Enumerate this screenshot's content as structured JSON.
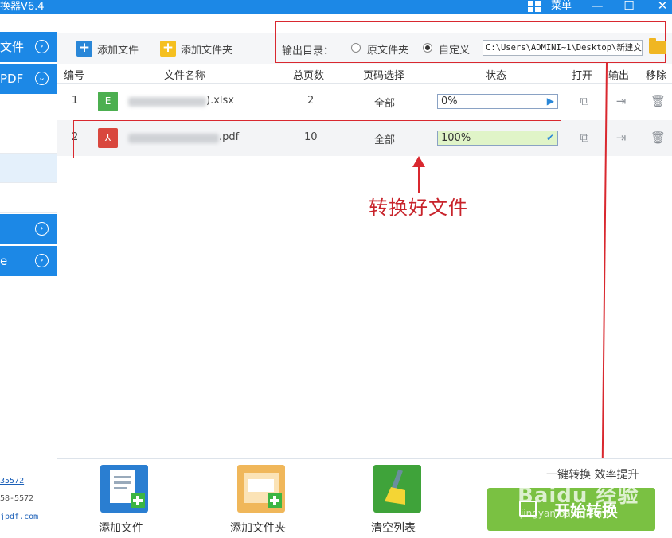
{
  "titlebar": {
    "app_title": "换器V6.4",
    "menu_label": "菜单",
    "minimize": "—",
    "maximize": "☐",
    "close": "✕"
  },
  "sidebar": {
    "section1": "文件",
    "section2": "PDF",
    "section3": "",
    "section4": "e",
    "link1": "35572",
    "phone": "58-5572",
    "link2": "jpdf.com"
  },
  "toolbar": {
    "add_file": "添加文件",
    "add_folder": "添加文件夹",
    "output_label": "输出目录：",
    "radio_original": "原文件夹",
    "radio_custom": "自定义",
    "output_path": "C:\\Users\\ADMINI~1\\Desktop\\新建文"
  },
  "table": {
    "headers": [
      "编号",
      "文件名称",
      "总页数",
      "页码选择",
      "状态",
      "打开",
      "输出",
      "移除"
    ],
    "rows": [
      {
        "index": "1",
        "type_letter": "E",
        "name_suffix": ").xlsx",
        "pages": "2",
        "page_select": "全部",
        "progress": "0%",
        "progress_fraction": 0
      },
      {
        "index": "2",
        "type_letter": "⅄",
        "name_suffix": ".pdf",
        "pages": "10",
        "page_select": "全部",
        "progress": "100%",
        "progress_fraction": 1
      }
    ]
  },
  "annotation": "转换好文件",
  "bottom": {
    "add_file": "添加文件",
    "add_folder": "添加文件夹",
    "clear_list": "清空列表",
    "slogan": "一键转换 效率提升",
    "start": "开始转换",
    "watermark": "Baidu 经验",
    "watermark_url": "jingyan.baidu.com"
  },
  "colors": {
    "brand_blue": "#1c88e6",
    "annotation_red": "#d9282f",
    "start_green": "#7ac142",
    "excel_green": "#4caf50",
    "pdf_red": "#d9473e"
  }
}
